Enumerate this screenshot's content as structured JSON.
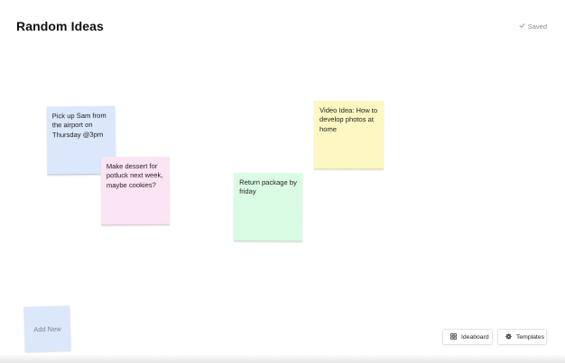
{
  "header": {
    "title": "Random Ideas",
    "saved_label": "Saved",
    "saved_icon": "check-icon"
  },
  "notes": [
    {
      "text": "Pick up Sam from the airport on Thursday @3pm",
      "color": "#dbe7fb"
    },
    {
      "text": "Make dessert for potluck next week, maybe cookies?",
      "color": "#fbe4f3"
    },
    {
      "text": "Return package by friday",
      "color": "#dafbe4"
    },
    {
      "text": "Video Idea: How to develop photos at home",
      "color": "#fdf7c2"
    }
  ],
  "add_new": {
    "label": "Add New",
    "color": "#dbe7fb"
  },
  "toolbar": {
    "ideaboard_label": "Ideaboard",
    "ideaboard_icon": "grid-icon",
    "templates_label": "Templates",
    "templates_icon": "gear-icon"
  }
}
